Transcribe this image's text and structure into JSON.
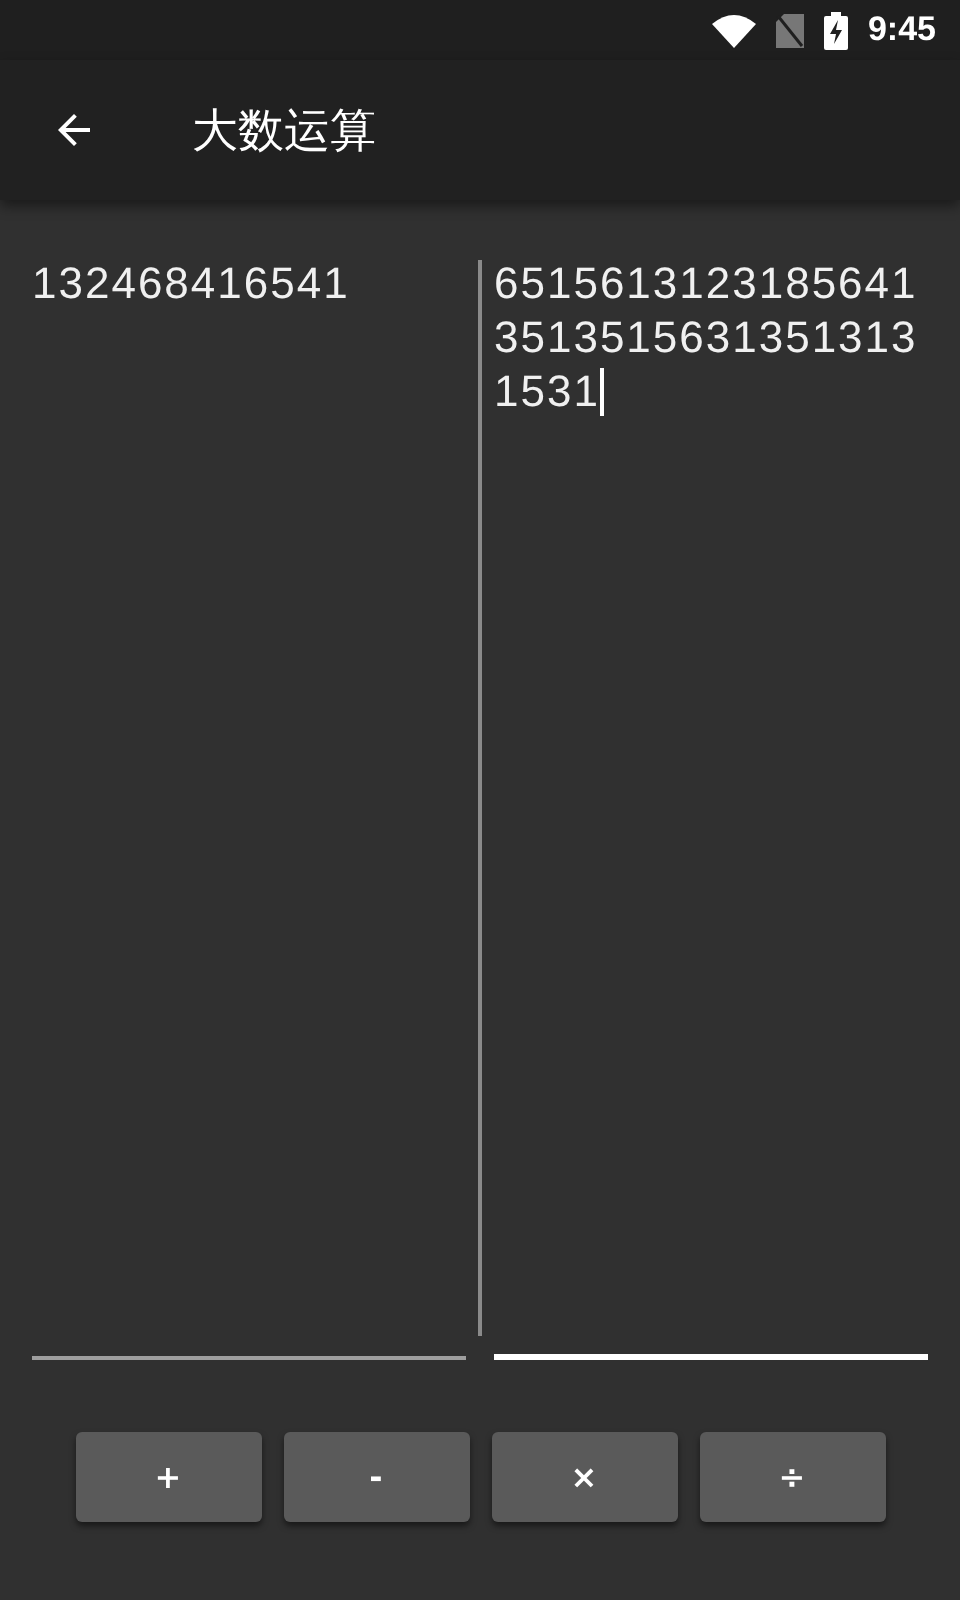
{
  "status_bar": {
    "time": "9:45"
  },
  "app_bar": {
    "title": "大数运算"
  },
  "fields": [
    {
      "value": "132468416541",
      "focused": false
    },
    {
      "value": "651561312318564135135156313513131531",
      "focused": true
    }
  ],
  "buttons": [
    {
      "label": "+"
    },
    {
      "label": "-"
    },
    {
      "label": "×"
    },
    {
      "label": "÷"
    }
  ]
}
